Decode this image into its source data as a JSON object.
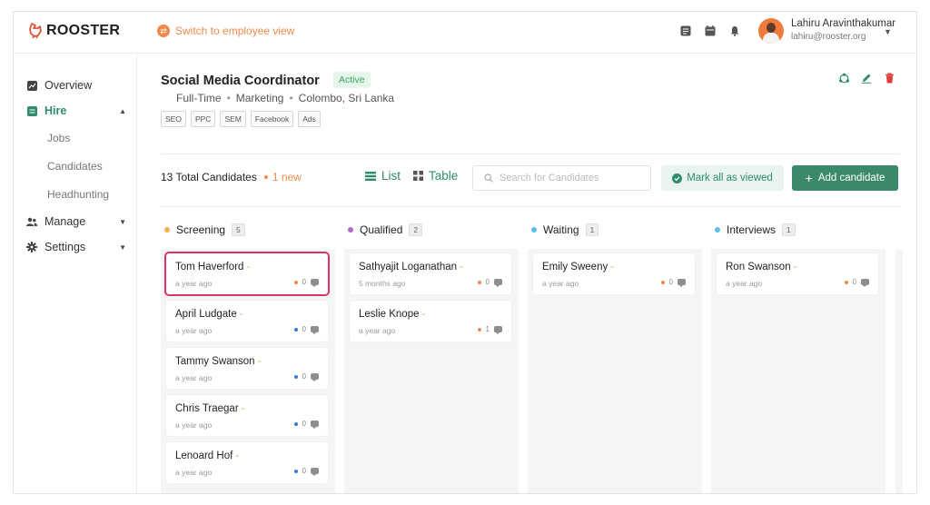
{
  "brand": {
    "name": "ROOSTER"
  },
  "header": {
    "switch_view": "Switch to employee view",
    "icons": [
      "task-icon",
      "calendar-icon",
      "bell-icon"
    ],
    "user": {
      "name": "Lahiru Aravinthakumar",
      "email": "lahiru@rooster.org"
    }
  },
  "sidebar": {
    "items": [
      {
        "label": "Overview",
        "icon": "chart-icon"
      },
      {
        "label": "Hire",
        "icon": "briefcase-icon",
        "active": true
      },
      {
        "label": "Manage",
        "icon": "users-icon"
      },
      {
        "label": "Settings",
        "icon": "gear-icon"
      }
    ],
    "hire_sub": [
      "Jobs",
      "Candidates",
      "Headhunting"
    ]
  },
  "job": {
    "title": "Social Media Coordinator",
    "status": "Active",
    "meta": [
      "Full-Time",
      "Marketing",
      "Colombo, Sri Lanka"
    ],
    "tags": [
      "SEO",
      "PPC",
      "SEM",
      "Facebook",
      "Ads"
    ]
  },
  "toolbar": {
    "total": "13 Total Candidates",
    "new": "1 new",
    "list_label": "List",
    "table_label": "Table",
    "search_placeholder": "Search for Candidates",
    "mark_all": "Mark all as viewed",
    "add_candidate": "Add candidate"
  },
  "colors": {
    "accent": "#3a8a6a",
    "orange": "#f08a4b",
    "selected": "#d9336b"
  },
  "columns": [
    {
      "name": "Screening",
      "count": "5",
      "color": "#f2b34a",
      "cards": [
        {
          "name": "Tom Haverford",
          "time": "a year ago",
          "comments": "0",
          "dot": "#f08a4b",
          "selected": true
        },
        {
          "name": "April Ludgate",
          "time": "a year ago",
          "comments": "0",
          "dot": "#3a7bd5"
        },
        {
          "name": "Tammy Swanson",
          "time": "a year ago",
          "comments": "0",
          "dot": "#3a7bd5"
        },
        {
          "name": "Chris Traegar",
          "time": "a year ago",
          "comments": "0",
          "dot": "#3a7bd5"
        },
        {
          "name": "Lenoard Hof",
          "time": "a year ago",
          "comments": "0",
          "dot": "#3a7bd5"
        }
      ]
    },
    {
      "name": "Qualified",
      "count": "2",
      "color": "#b569c9",
      "cards": [
        {
          "name": "Sathyajit Loganathan",
          "time": "5 months ago",
          "comments": "0",
          "dot": "#f08a4b"
        },
        {
          "name": "Leslie Knope",
          "time": "a year ago",
          "comments": "1",
          "dot": "#f08a4b"
        }
      ]
    },
    {
      "name": "Waiting",
      "count": "1",
      "color": "#5bc0eb",
      "cards": [
        {
          "name": "Emily Sweeny",
          "time": "a year ago",
          "comments": "0",
          "dot": "#f08a4b"
        }
      ]
    },
    {
      "name": "Interviews",
      "count": "1",
      "color": "#5bc0eb",
      "cards": [
        {
          "name": "Ron Swanson",
          "time": "a year ago",
          "comments": "0",
          "dot": "#f08a4b"
        }
      ]
    }
  ]
}
